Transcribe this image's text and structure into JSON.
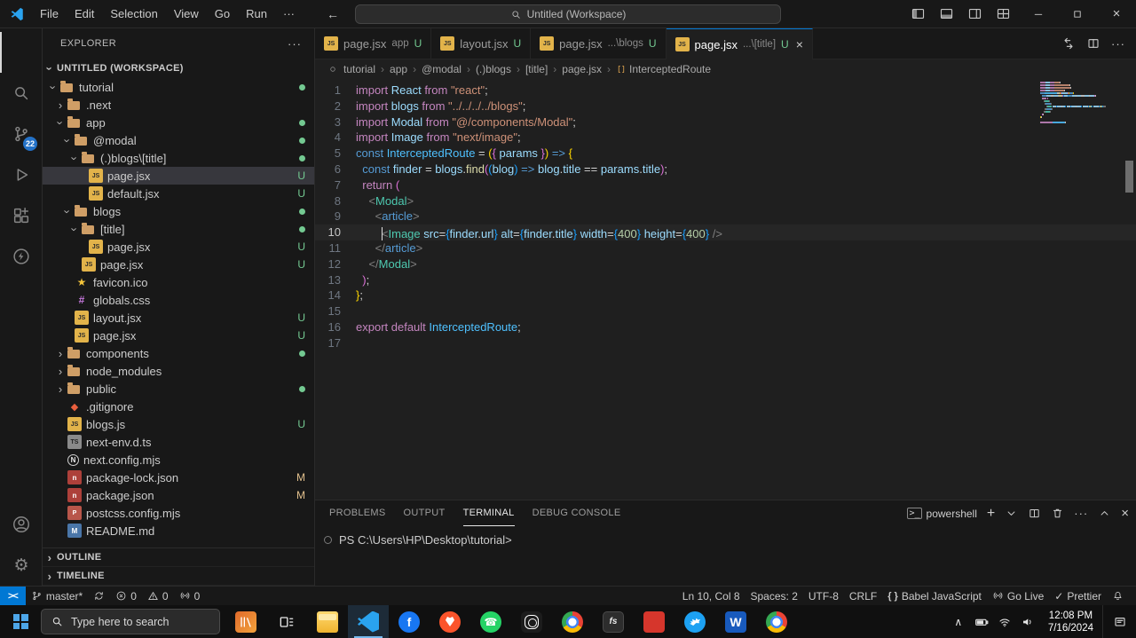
{
  "window": {
    "title": "Untitled (Workspace)",
    "menus": [
      "File",
      "Edit",
      "Selection",
      "View",
      "Go",
      "Run",
      "···"
    ]
  },
  "activity_bar": {
    "top": [
      {
        "name": "explorer",
        "active": true
      },
      {
        "name": "search"
      },
      {
        "name": "source-control",
        "badge": "22"
      },
      {
        "name": "run-debug"
      },
      {
        "name": "extensions"
      },
      {
        "name": "thunder-client"
      }
    ],
    "bottom": [
      {
        "name": "accounts"
      },
      {
        "name": "settings"
      }
    ]
  },
  "explorer": {
    "title": "EXPLORER",
    "workspace": "UNTITLED (WORKSPACE)",
    "sections": [
      "OUTLINE",
      "TIMELINE"
    ],
    "tree": [
      {
        "l": "tutorial",
        "d": 0,
        "t": "d",
        "e": true,
        "dot": true
      },
      {
        "l": ".next",
        "d": 1,
        "t": "d",
        "e": false
      },
      {
        "l": "app",
        "d": 1,
        "t": "d",
        "e": true,
        "dot": true
      },
      {
        "l": "@modal",
        "d": 2,
        "t": "d",
        "e": true,
        "dot": true
      },
      {
        "l": "(.)blogs\\[title]",
        "d": 3,
        "t": "d",
        "e": true,
        "dot": true
      },
      {
        "l": "page.jsx",
        "d": 4,
        "t": "f",
        "i": "js",
        "g": "U",
        "sel": true
      },
      {
        "l": "default.jsx",
        "d": 4,
        "t": "f",
        "i": "js",
        "g": "U"
      },
      {
        "l": "blogs",
        "d": 2,
        "t": "d",
        "e": true,
        "dot": true
      },
      {
        "l": "[title]",
        "d": 3,
        "t": "d",
        "e": true,
        "dot": true
      },
      {
        "l": "page.jsx",
        "d": 4,
        "t": "f",
        "i": "js",
        "g": "U"
      },
      {
        "l": "page.jsx",
        "d": 3,
        "t": "f",
        "i": "js",
        "g": "U"
      },
      {
        "l": "favicon.ico",
        "d": 2,
        "t": "f",
        "i": "star"
      },
      {
        "l": "globals.css",
        "d": 2,
        "t": "f",
        "i": "css"
      },
      {
        "l": "layout.jsx",
        "d": 2,
        "t": "f",
        "i": "js",
        "g": "U"
      },
      {
        "l": "page.jsx",
        "d": 2,
        "t": "f",
        "i": "js",
        "g": "U"
      },
      {
        "l": "components",
        "d": 1,
        "t": "d",
        "e": false,
        "dot": true
      },
      {
        "l": "node_modules",
        "d": 1,
        "t": "d",
        "e": false
      },
      {
        "l": "public",
        "d": 1,
        "t": "d",
        "e": false,
        "dot": true
      },
      {
        "l": ".gitignore",
        "d": 1,
        "t": "f",
        "i": "git"
      },
      {
        "l": "blogs.js",
        "d": 1,
        "t": "f",
        "i": "js",
        "g": "U"
      },
      {
        "l": "next-env.d.ts",
        "d": 1,
        "t": "f",
        "i": "ts"
      },
      {
        "l": "next.config.mjs",
        "d": 1,
        "t": "f",
        "i": "nextconf"
      },
      {
        "l": "package-lock.json",
        "d": 1,
        "t": "f",
        "i": "npm",
        "g": "M"
      },
      {
        "l": "package.json",
        "d": 1,
        "t": "f",
        "i": "npm",
        "g": "M"
      },
      {
        "l": "postcss.config.mjs",
        "d": 1,
        "t": "f",
        "i": "postcss"
      },
      {
        "l": "README.md",
        "d": 1,
        "t": "f",
        "i": "md"
      }
    ]
  },
  "tabs": [
    {
      "name": "page.jsx",
      "hint": "app",
      "badge": "U",
      "active": false
    },
    {
      "name": "layout.jsx",
      "hint": "",
      "badge": "U",
      "active": false
    },
    {
      "name": "page.jsx",
      "hint": "...\\blogs",
      "badge": "U",
      "active": false
    },
    {
      "name": "page.jsx",
      "hint": "...\\[title]",
      "badge": "U",
      "active": true
    }
  ],
  "breadcrumbs": [
    "tutorial",
    "app",
    "@modal",
    "(.)blogs",
    "[title]",
    "page.jsx",
    "InterceptedRoute"
  ],
  "editor": {
    "active_line": 10,
    "lines": [
      {
        "n": 1,
        "tokens": [
          [
            "kw",
            "import "
          ],
          [
            "id",
            "React"
          ],
          [
            "kw",
            " from "
          ],
          [
            "str",
            "\"react\""
          ],
          [
            "pn",
            ";"
          ]
        ]
      },
      {
        "n": 2,
        "tokens": [
          [
            "kw",
            "import "
          ],
          [
            "id",
            "blogs"
          ],
          [
            "kw",
            " from "
          ],
          [
            "str",
            "\"../../../../blogs\""
          ],
          [
            "pn",
            ";"
          ]
        ]
      },
      {
        "n": 3,
        "tokens": [
          [
            "kw",
            "import "
          ],
          [
            "id",
            "Modal"
          ],
          [
            "kw",
            " from "
          ],
          [
            "str",
            "\"@/components/Modal\""
          ],
          [
            "pn",
            ";"
          ]
        ]
      },
      {
        "n": 4,
        "tokens": [
          [
            "kw",
            "import "
          ],
          [
            "id",
            "Image"
          ],
          [
            "kw",
            " from "
          ],
          [
            "str",
            "\"next/image\""
          ],
          [
            "pn",
            ";"
          ]
        ]
      },
      {
        "n": 5,
        "tokens": [
          [
            "st",
            "const "
          ],
          [
            "cid",
            "InterceptedRoute"
          ],
          [
            "op",
            " = "
          ],
          [
            "b1",
            "("
          ],
          [
            "b2",
            "{"
          ],
          [
            "id",
            " params "
          ],
          [
            "b2",
            "}"
          ],
          [
            "b1",
            ")"
          ],
          [
            "st",
            " => "
          ],
          [
            "b1",
            "{"
          ]
        ]
      },
      {
        "n": 6,
        "tokens": [
          [
            "op",
            "  "
          ],
          [
            "st",
            "const "
          ],
          [
            "id",
            "finder"
          ],
          [
            "op",
            " = "
          ],
          [
            "id",
            "blogs"
          ],
          [
            "pn",
            "."
          ],
          [
            "fn",
            "find"
          ],
          [
            "b2",
            "("
          ],
          [
            "b3",
            "("
          ],
          [
            "id",
            "blog"
          ],
          [
            "b3",
            ")"
          ],
          [
            "st",
            " => "
          ],
          [
            "id",
            "blog"
          ],
          [
            "pn",
            "."
          ],
          [
            "id",
            "title"
          ],
          [
            "op",
            " == "
          ],
          [
            "id",
            "params"
          ],
          [
            "pn",
            "."
          ],
          [
            "id",
            "title"
          ],
          [
            "b2",
            ")"
          ],
          [
            "pn",
            ";"
          ]
        ]
      },
      {
        "n": 7,
        "tokens": [
          [
            "op",
            "  "
          ],
          [
            "kw",
            "return"
          ],
          [
            "op",
            " "
          ],
          [
            "b2",
            "("
          ]
        ]
      },
      {
        "n": 8,
        "tokens": [
          [
            "op",
            "    "
          ],
          [
            "ang",
            "<"
          ],
          [
            "tag",
            "Modal"
          ],
          [
            "ang",
            ">"
          ]
        ]
      },
      {
        "n": 9,
        "tokens": [
          [
            "op",
            "      "
          ],
          [
            "ang",
            "<"
          ],
          [
            "htag",
            "article"
          ],
          [
            "ang",
            ">"
          ]
        ]
      },
      {
        "n": 10,
        "tokens": [
          [
            "op",
            "        "
          ],
          [
            "cur",
            ""
          ],
          [
            "ang",
            "<"
          ],
          [
            "tag",
            "Image"
          ],
          [
            "op",
            " "
          ],
          [
            "id",
            "src"
          ],
          [
            "op",
            "="
          ],
          [
            "b3",
            "{"
          ],
          [
            "id",
            "finder"
          ],
          [
            "pn",
            "."
          ],
          [
            "id",
            "url"
          ],
          [
            "b3",
            "}"
          ],
          [
            "op",
            " "
          ],
          [
            "id",
            "alt"
          ],
          [
            "op",
            "="
          ],
          [
            "b3",
            "{"
          ],
          [
            "id",
            "finder"
          ],
          [
            "pn",
            "."
          ],
          [
            "id",
            "title"
          ],
          [
            "b3",
            "}"
          ],
          [
            "op",
            " "
          ],
          [
            "id",
            "width"
          ],
          [
            "op",
            "="
          ],
          [
            "b3",
            "{"
          ],
          [
            "num",
            "400"
          ],
          [
            "b3",
            "}"
          ],
          [
            "op",
            " "
          ],
          [
            "id",
            "height"
          ],
          [
            "op",
            "="
          ],
          [
            "b3",
            "{"
          ],
          [
            "num",
            "400"
          ],
          [
            "b3",
            "}"
          ],
          [
            "ang",
            " />"
          ]
        ]
      },
      {
        "n": 11,
        "tokens": [
          [
            "op",
            "      "
          ],
          [
            "ang",
            "</"
          ],
          [
            "htag",
            "article"
          ],
          [
            "ang",
            ">"
          ]
        ]
      },
      {
        "n": 12,
        "tokens": [
          [
            "op",
            "    "
          ],
          [
            "ang",
            "</"
          ],
          [
            "tag",
            "Modal"
          ],
          [
            "ang",
            ">"
          ]
        ]
      },
      {
        "n": 13,
        "tokens": [
          [
            "op",
            "  "
          ],
          [
            "b2",
            ")"
          ],
          [
            "pn",
            ";"
          ]
        ]
      },
      {
        "n": 14,
        "tokens": [
          [
            "b1",
            "}"
          ],
          [
            "pn",
            ";"
          ]
        ]
      },
      {
        "n": 15,
        "tokens": []
      },
      {
        "n": 16,
        "tokens": [
          [
            "kw",
            "export default "
          ],
          [
            "cid",
            "InterceptedRoute"
          ],
          [
            "pn",
            ";"
          ]
        ]
      },
      {
        "n": 17,
        "tokens": []
      }
    ]
  },
  "panel": {
    "tabs": [
      {
        "label": "PROBLEMS"
      },
      {
        "label": "OUTPUT"
      },
      {
        "label": "TERMINAL",
        "active": true
      },
      {
        "label": "DEBUG CONSOLE"
      }
    ],
    "shell": "powershell",
    "prompt": "PS C:\\Users\\HP\\Desktop\\tutorial>"
  },
  "status_bar": {
    "remote": "><",
    "left": [
      {
        "name": "git-branch",
        "icon": "branch",
        "label": "master*"
      },
      {
        "name": "git-sync",
        "icon": "sync",
        "label": ""
      },
      {
        "name": "errors",
        "icon": "error",
        "label": "0"
      },
      {
        "name": "warnings",
        "icon": "warning",
        "label": "0"
      },
      {
        "name": "ports",
        "icon": "broadcast",
        "label": "0"
      }
    ],
    "right": [
      {
        "name": "cursor-position",
        "icon": "",
        "label": "Ln 10, Col 8"
      },
      {
        "name": "indentation",
        "icon": "",
        "label": "Spaces: 2"
      },
      {
        "name": "encoding",
        "icon": "",
        "label": "UTF-8"
      },
      {
        "name": "eol",
        "icon": "",
        "label": "CRLF"
      },
      {
        "name": "language-mode",
        "icon": "braces",
        "label": "Babel JavaScript"
      },
      {
        "name": "go-live",
        "icon": "broadcast",
        "label": "Go Live"
      },
      {
        "name": "prettier",
        "icon": "check",
        "label": "Prettier"
      },
      {
        "name": "notifications",
        "icon": "bell",
        "label": ""
      }
    ]
  },
  "taskbar": {
    "search_placeholder": "Type here to search",
    "pinned": [
      {
        "name": "library"
      },
      {
        "name": "task-view"
      },
      {
        "name": "file-explorer"
      },
      {
        "name": "vscode",
        "active": true
      },
      {
        "name": "facebook"
      },
      {
        "name": "brave"
      },
      {
        "name": "whatsapp"
      },
      {
        "name": "instagram"
      },
      {
        "name": "chrome"
      },
      {
        "name": "fresco",
        "label": "fs"
      },
      {
        "name": "adobe"
      },
      {
        "name": "twitter"
      },
      {
        "name": "word"
      },
      {
        "name": "browser"
      }
    ],
    "tray": {
      "time": "12:08 PM",
      "date": "7/16/2024"
    }
  }
}
